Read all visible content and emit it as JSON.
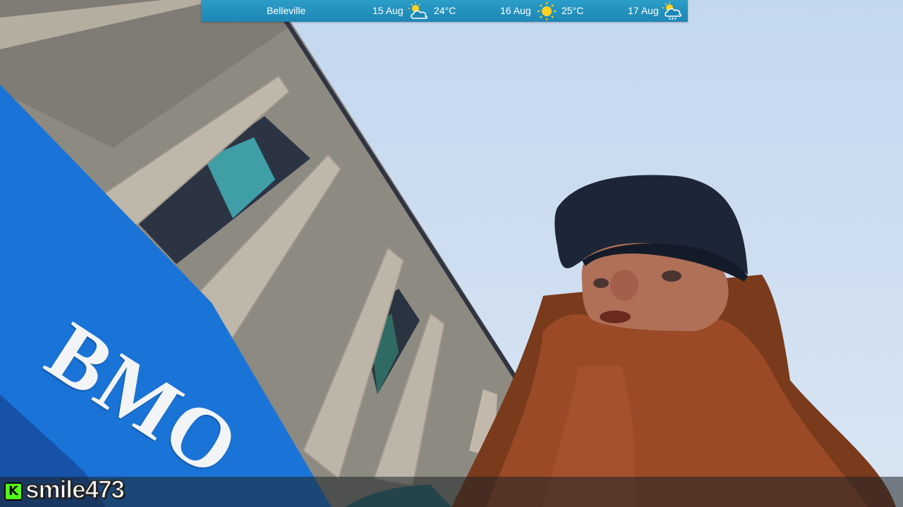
{
  "weather": {
    "city": "Belleville",
    "days": [
      {
        "date": "15 Aug",
        "icon": "sun-cloud-icon",
        "temp": "24°C"
      },
      {
        "date": "16 Aug",
        "icon": "sun-icon",
        "temp": "25°C"
      },
      {
        "date": "17 Aug",
        "icon": "sun-cloud-rain-icon",
        "temp": ""
      }
    ],
    "accent": "#2b9ec8"
  },
  "scene": {
    "sign_text": "BMO",
    "sign_color": "#1a74d8"
  },
  "stream": {
    "platform_icon": "kick-logo-icon",
    "platform_letter": "K",
    "username": "smile473",
    "platform_color": "#53fc18"
  }
}
